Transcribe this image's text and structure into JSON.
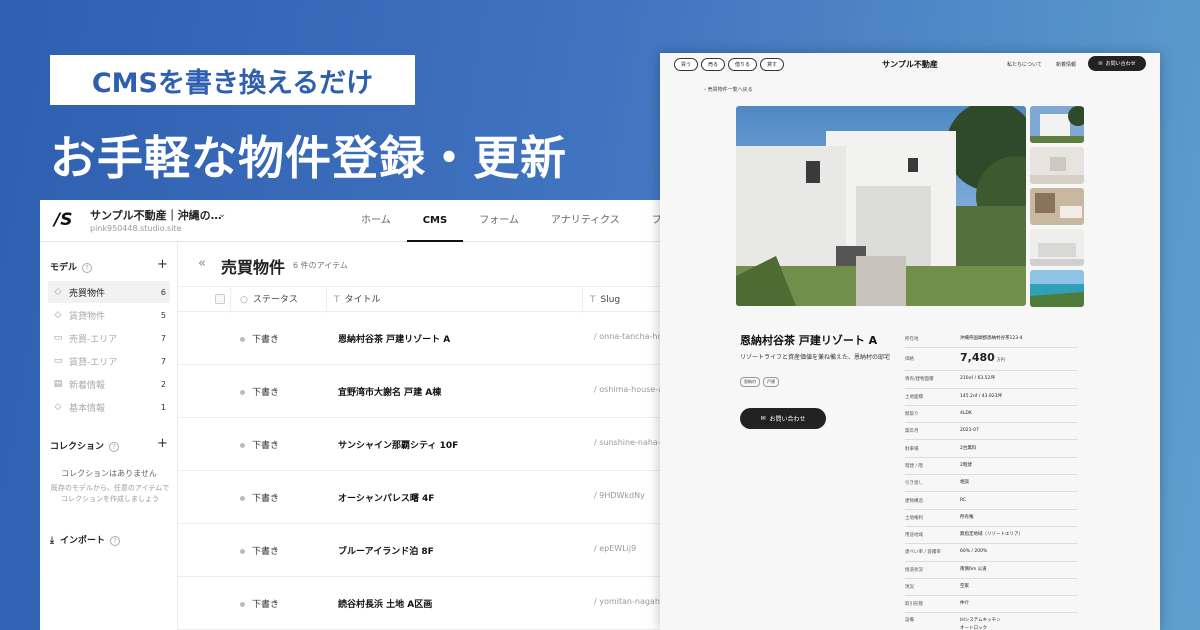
{
  "hero": {
    "tag": "CMSを書き換えるだけ",
    "title": "お手軽な物件登録・更新"
  },
  "cms": {
    "logo": "/S",
    "site_name": "サンプル不動産｜沖縄の…",
    "site_url": "pink950448.studio.site",
    "nav": [
      "ホーム",
      "CMS",
      "フォーム",
      "アナリティクス",
      "プラン"
    ],
    "active_nav": "CMS",
    "sidebar": {
      "models_heading": "モデル",
      "models": [
        {
          "label": "売買物件",
          "count": "6",
          "icon": "tag-icon",
          "active": true
        },
        {
          "label": "賃貸物件",
          "count": "5",
          "icon": "tag-icon",
          "active": false
        },
        {
          "label": "売買-エリア",
          "count": "7",
          "icon": "folder-icon",
          "active": false
        },
        {
          "label": "賃貸-エリア",
          "count": "7",
          "icon": "folder-icon",
          "active": false
        },
        {
          "label": "新着情報",
          "count": "2",
          "icon": "document-icon",
          "active": false
        },
        {
          "label": "基本情報",
          "count": "1",
          "icon": "tag-icon",
          "active": false
        }
      ],
      "collections_heading": "コレクション",
      "collections_empty": "コレクションはありません",
      "collections_note": "既存のモデルから、任意のアイテムでコレクションを作成しましょう",
      "import_label": "インポート"
    },
    "main": {
      "title": "売買物件",
      "item_count": "6 件のアイテム",
      "columns": [
        {
          "label": "ステータス",
          "icon": "circle-icon"
        },
        {
          "label": "タイトル",
          "icon": "text-icon"
        },
        {
          "label": "Slug",
          "icon": "text-icon"
        }
      ],
      "rows": [
        {
          "status": "下書き",
          "title": "恩納村谷茶 戸建リゾート A",
          "slug": "/ onna-tancha-ho..."
        },
        {
          "status": "下書き",
          "title": "宜野湾市大謝名 戸建 A棟",
          "slug": "/ oshima-house-a"
        },
        {
          "status": "下書き",
          "title": "サンシャイン那覇シティ 10F",
          "slug": "/ sunshine-naha-c"
        },
        {
          "status": "下書き",
          "title": "オーシャンパレス曙 4F",
          "slug": "/ 9HDWkdNy"
        },
        {
          "status": "下書き",
          "title": "ブルーアイランド泊 8F",
          "slug": "/ epEWLij9"
        },
        {
          "status": "下書き",
          "title": "読谷村長浜 土地 A区画",
          "slug": "/ yomitan-nagaha..."
        }
      ]
    }
  },
  "site": {
    "pills": [
      "買う",
      "売る",
      "借りる",
      "貸す"
    ],
    "brand": "サンプル不動産",
    "about": "私たちについて",
    "news": "新着情報",
    "contact": "お問い合わせ",
    "back": "‹ 売買物件一覧へ戻る",
    "property": {
      "title": "恩納村谷茶 戸建リゾート A",
      "description": "リゾートライフと資産価値を兼ね備えた、恩納村の邸宅",
      "tags": [
        "恩納村",
        "戸建"
      ],
      "inquiry_button": "お問い合わせ"
    },
    "specs": [
      {
        "key": "所在地",
        "value": "沖縄県国頭郡恩納村谷茶123-4"
      },
      {
        "key": "価格",
        "value": "7,480",
        "unit": "万円"
      },
      {
        "key": "専有/建物面積",
        "value": "210㎡ / 63.52坪"
      },
      {
        "key": "土地面積",
        "value": "145.2㎡ / 43.923坪"
      },
      {
        "key": "間取り",
        "value": "4LDK"
      },
      {
        "key": "築年月",
        "value": "2021-07"
      },
      {
        "key": "駐車場",
        "value": "2台無料"
      },
      {
        "key": "階建 / 階",
        "value": "2階建"
      },
      {
        "key": "引き渡し",
        "value": "相談"
      },
      {
        "key": "建物構造",
        "value": "RC"
      },
      {
        "key": "土地権利",
        "value": "所有権"
      },
      {
        "key": "用途地域",
        "value": "無指定地域（リゾートエリア）"
      },
      {
        "key": "建ぺい率 / 容積率",
        "value": "60% / 200%"
      },
      {
        "key": "接道状況",
        "value": "南側6m 公道"
      },
      {
        "key": "現況",
        "value": "空家"
      },
      {
        "key": "取引形態",
        "value": "仲介"
      },
      {
        "key": "設備",
        "value": "IHシステムキッチン\nオートロック"
      }
    ]
  },
  "colors": {
    "bg_start": "#2f5fb0",
    "bg_end": "#5f9fce",
    "accent_text": "#2f5fb0",
    "dark_button": "#222222"
  }
}
